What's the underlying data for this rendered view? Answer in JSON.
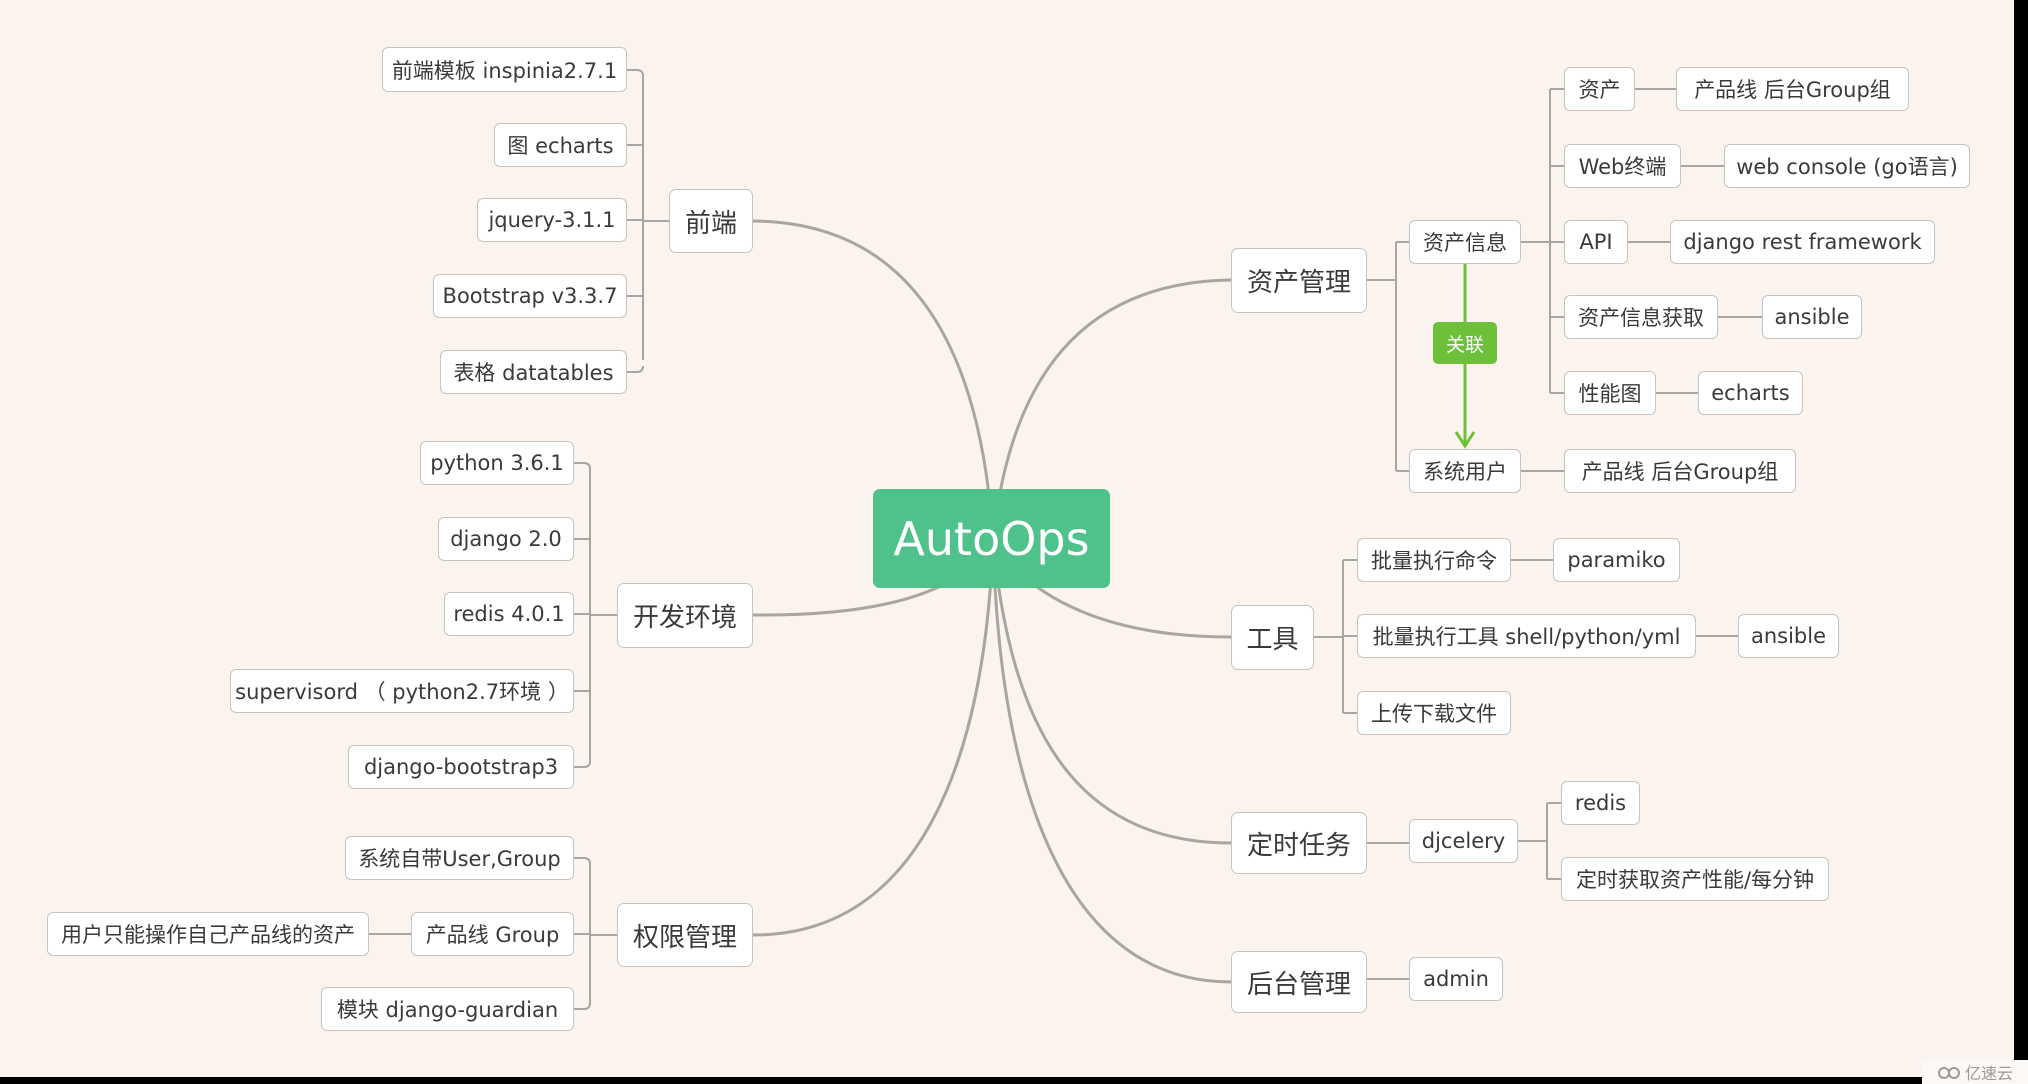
{
  "root": {
    "label": "AutoOps"
  },
  "colors": {
    "background": "#fbf3ee",
    "root": "#4fc28b",
    "relation": "#6cc03a",
    "line": "#a9a5a2"
  },
  "left": {
    "frontend": {
      "label": "前端",
      "children": [
        "前端模板 inspinia2.7.1",
        "图 echarts",
        "jquery-3.1.1",
        "Bootstrap v3.3.7",
        "表格 datatables"
      ]
    },
    "devenv": {
      "label": "开发环境",
      "children": [
        "python 3.6.1",
        "django 2.0",
        "redis 4.0.1",
        "supervisord （ python2.7环境 ）",
        "django-bootstrap3"
      ]
    },
    "permission": {
      "label": "权限管理",
      "children": [
        "系统自带User,Group",
        "产品线 Group",
        "模块 django-guardian"
      ],
      "product_group_child": "用户只能操作自己产品线的资产"
    }
  },
  "right": {
    "asset": {
      "label": "资产管理",
      "asset_info": {
        "label": "资产信息",
        "children": [
          {
            "label": "资产",
            "child": "产品线  后台Group组"
          },
          {
            "label": "Web终端",
            "child": "web console (go语言)"
          },
          {
            "label": "API",
            "child": "django rest framework"
          },
          {
            "label": "资产信息获取",
            "child": "ansible"
          },
          {
            "label": "性能图",
            "child": "echarts"
          }
        ]
      },
      "relation_label": "关联",
      "system_user": {
        "label": "系统用户",
        "child": "产品线  后台Group组"
      }
    },
    "tools": {
      "label": "工具",
      "children": [
        {
          "label": "批量执行命令",
          "child": "paramiko"
        },
        {
          "label": "批量执行工具 shell/python/yml",
          "child": "ansible"
        },
        {
          "label": "上传下载文件"
        }
      ]
    },
    "cron": {
      "label": "定时任务",
      "djcelery": {
        "label": "djcelery",
        "children": [
          "redis",
          "定时获取资产性能/每分钟"
        ]
      }
    },
    "admin": {
      "label": "后台管理",
      "children": [
        "admin"
      ]
    }
  },
  "watermark": {
    "text": "亿速云"
  }
}
